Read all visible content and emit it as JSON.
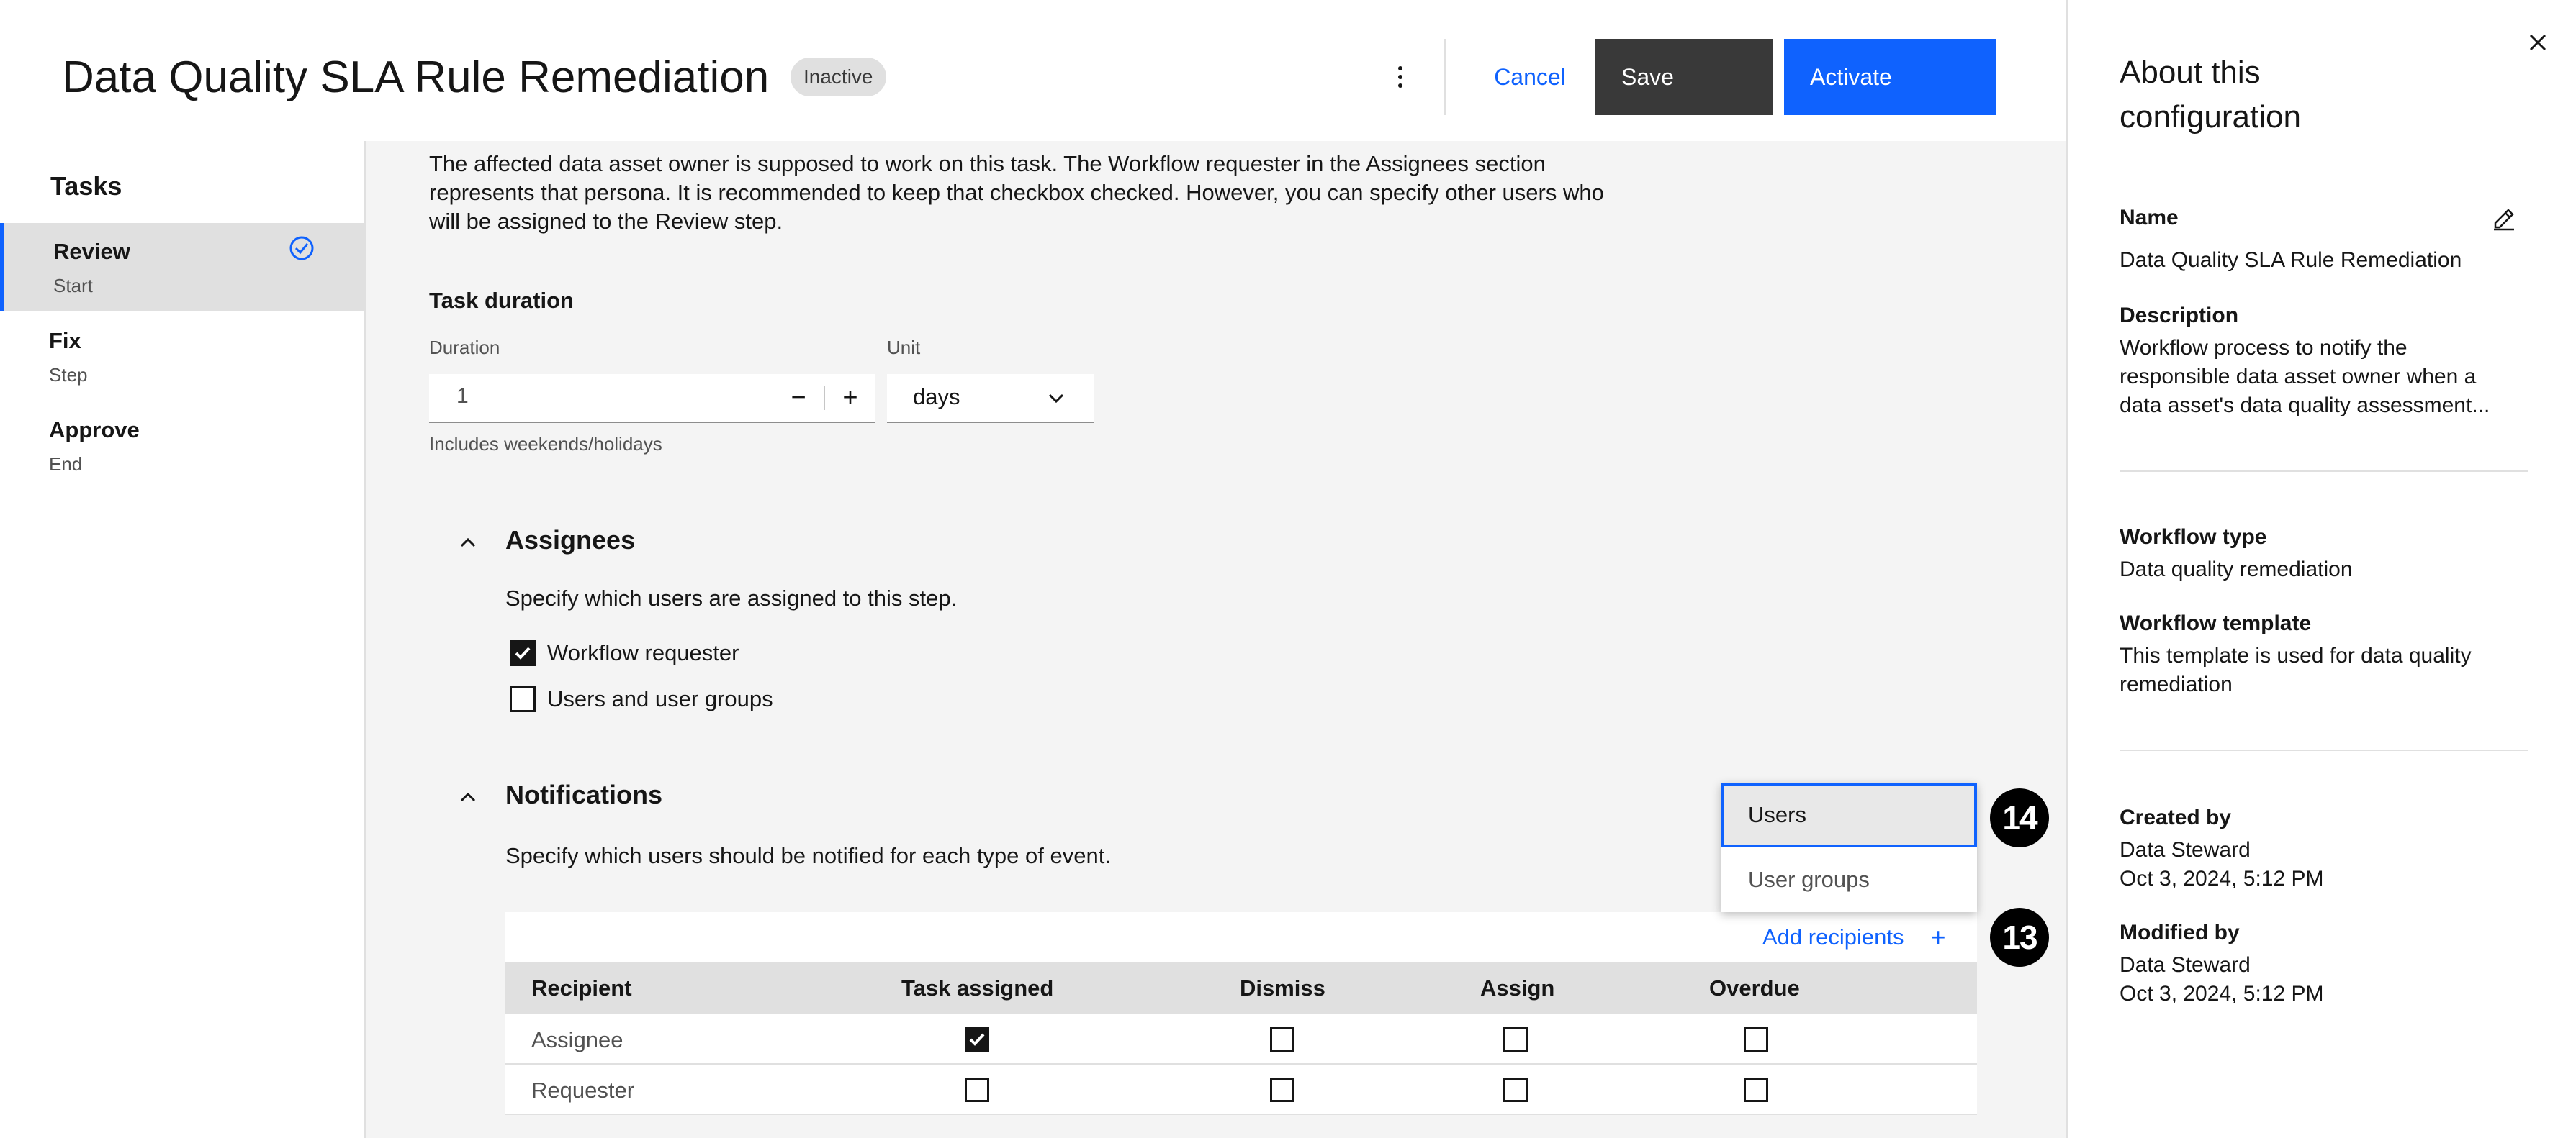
{
  "header": {
    "title": "Data Quality SLA Rule Remediation",
    "status": "Inactive",
    "cancel_label": "Cancel",
    "save_label": "Save",
    "activate_label": "Activate"
  },
  "tasks_nav": {
    "heading": "Tasks",
    "items": [
      {
        "label": "Review",
        "sub": "Start"
      },
      {
        "label": "Fix",
        "sub": "Step"
      },
      {
        "label": "Approve",
        "sub": "End"
      }
    ]
  },
  "main": {
    "intro": "The affected data asset owner is supposed to work on this task. The Workflow requester in the Assignees section represents that persona. It is recommended to keep that checkbox checked. However, you can specify other users who will be assigned to the Review step.",
    "task_duration": {
      "heading": "Task duration",
      "duration_label": "Duration",
      "duration_value": "1",
      "decrement": "−",
      "increment": "+",
      "unit_label": "Unit",
      "unit_value": "days",
      "helper": "Includes weekends/holidays"
    },
    "assignees": {
      "heading": "Assignees",
      "description": "Specify which users are assigned to this step.",
      "options": [
        {
          "label": "Workflow requester",
          "checked": true
        },
        {
          "label": "Users and user groups",
          "checked": false
        }
      ]
    },
    "notifications": {
      "heading": "Notifications",
      "description": "Specify which users should be notified for each type of event.",
      "add_recipients_label": "Add recipients",
      "add_icon": "+",
      "menu": [
        "Users",
        "User groups"
      ],
      "columns": [
        "Recipient",
        "Task assigned",
        "Dismiss",
        "Assign",
        "Overdue"
      ],
      "rows": [
        {
          "recipient": "Assignee",
          "values": [
            true,
            false,
            false,
            false
          ]
        },
        {
          "recipient": "Requester",
          "values": [
            false,
            false,
            false,
            false
          ]
        }
      ]
    }
  },
  "markers": [
    "14",
    "13"
  ],
  "about": {
    "title": "About this configuration",
    "name_label": "Name",
    "name_value": "Data Quality SLA Rule Remediation",
    "description_label": "Description",
    "description_value": "Workflow process to notify the responsible data asset owner when a data asset's data quality assessment...",
    "workflow_type_label": "Workflow type",
    "workflow_type_value": "Data quality remediation",
    "workflow_template_label": "Workflow template",
    "workflow_template_value": "This template is used for data quality remediation",
    "created_by_label": "Created by",
    "created_by_name": "Data Steward",
    "created_by_date": "Oct 3, 2024, 5:12 PM",
    "modified_by_label": "Modified by",
    "modified_by_name": "Data Steward",
    "modified_by_date": "Oct 3, 2024, 5:12 PM"
  },
  "colors": {
    "primary": "#0f62fe",
    "secondary_button": "#393939",
    "marker": "#000000"
  }
}
